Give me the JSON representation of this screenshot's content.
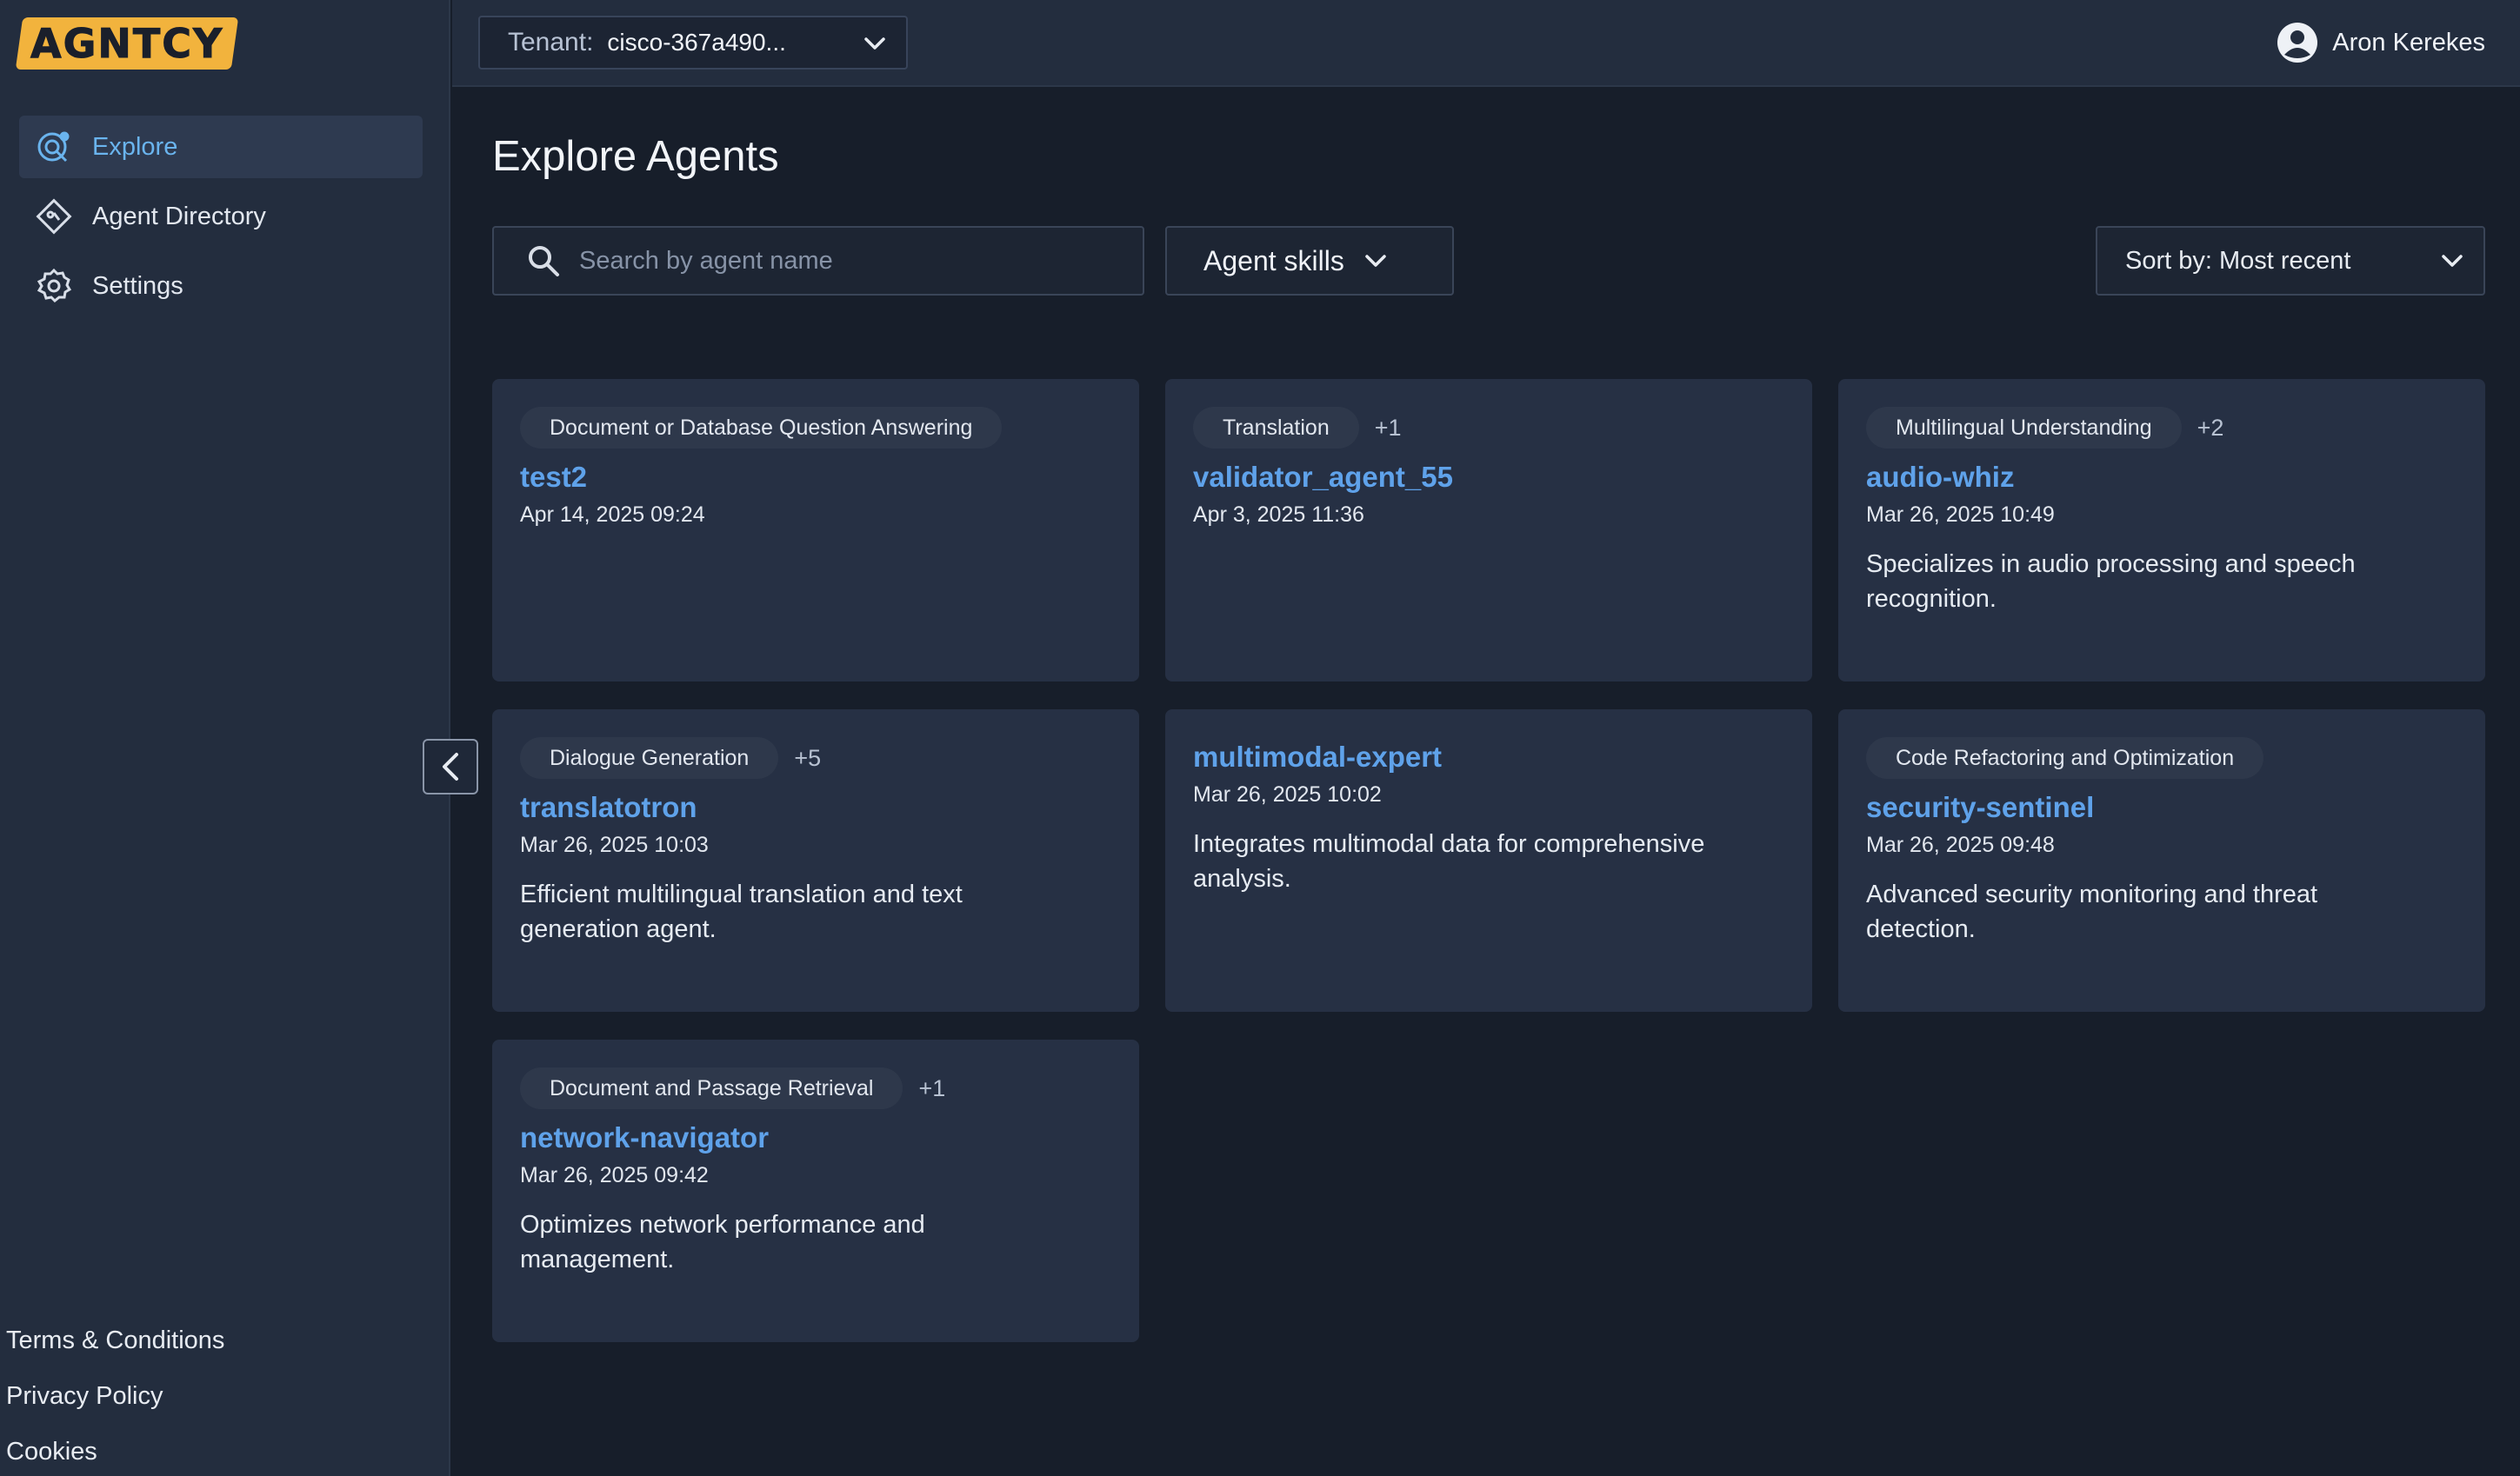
{
  "logo": {
    "text": "AGNTCY"
  },
  "sidebar": {
    "items": [
      {
        "label": "Explore",
        "icon": "explore-icon",
        "active": true
      },
      {
        "label": "Agent Directory",
        "icon": "agent-directory-icon",
        "active": false
      },
      {
        "label": "Settings",
        "icon": "gear-icon",
        "active": false
      }
    ],
    "footer": [
      "Terms & Conditions",
      "Privacy Policy",
      "Cookies"
    ]
  },
  "topbar": {
    "tenant_label": "Tenant:",
    "tenant_value": "cisco-367a490...",
    "user_name": "Aron Kerekes"
  },
  "main": {
    "title": "Explore Agents",
    "search_placeholder": "Search by agent name",
    "skills_label": "Agent skills",
    "sort_label": "Sort by: Most recent"
  },
  "cards": [
    {
      "tag": "Document or Database Question Answering",
      "more": "",
      "name": "test2",
      "date": "Apr 14, 2025 09:24",
      "desc": ""
    },
    {
      "tag": "Translation",
      "more": "+1",
      "name": "validator_agent_55",
      "date": "Apr 3, 2025 11:36",
      "desc": ""
    },
    {
      "tag": "Multilingual Understanding",
      "more": "+2",
      "name": "audio-whiz",
      "date": "Mar 26, 2025 10:49",
      "desc": "Specializes in audio processing and speech recognition."
    },
    {
      "tag": "Dialogue Generation",
      "more": "+5",
      "name": "translatotron",
      "date": "Mar 26, 2025 10:03",
      "desc": "Efficient multilingual translation and text generation agent."
    },
    {
      "tag": "",
      "more": "",
      "name": "multimodal-expert",
      "date": "Mar 26, 2025 10:02",
      "desc": "Integrates multimodal data for comprehensive analysis."
    },
    {
      "tag": "Code Refactoring and Optimization",
      "more": "",
      "name": "security-sentinel",
      "date": "Mar 26, 2025 09:48",
      "desc": "Advanced security monitoring and threat detection."
    },
    {
      "tag": "Document and Passage Retrieval",
      "more": "+1",
      "name": "network-navigator",
      "date": "Mar 26, 2025 09:42",
      "desc": "Optimizes network performance and management."
    }
  ],
  "colors": {
    "background": "#171e2a",
    "sidebar": "#232d3e",
    "card": "#263044",
    "accent": "#6ab4ee",
    "agent_name": "#5fa2ea",
    "logo": "#f2b33d"
  }
}
